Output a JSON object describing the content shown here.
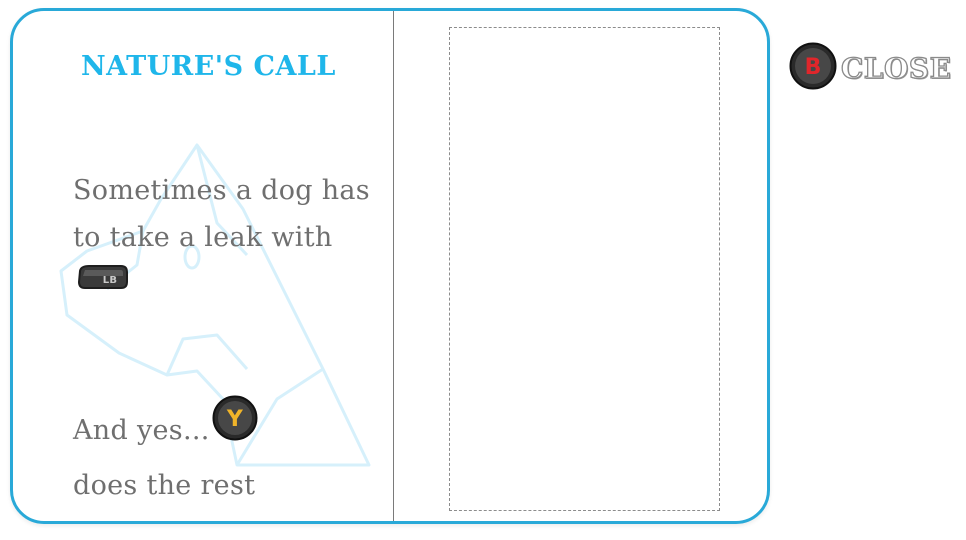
{
  "title": "NATURE'S CALL",
  "tips": {
    "line1": "Sometimes a dog has to take a leak with",
    "line1_button": "LB",
    "line2_start": "And yes...",
    "line2_button": "Y",
    "line2_end": "does the rest"
  },
  "close": {
    "button": "B",
    "label": "CLOSE"
  },
  "icons": {
    "watermark": "dog-head-icon",
    "lb": "lb-button-icon",
    "y": "y-button-icon",
    "b": "b-button-icon"
  },
  "colors": {
    "accent": "#1fb6ea",
    "border": "#29a9d8",
    "text": "#6f6f6f",
    "y_button": "#f0b429",
    "b_button": "#e0262b"
  }
}
